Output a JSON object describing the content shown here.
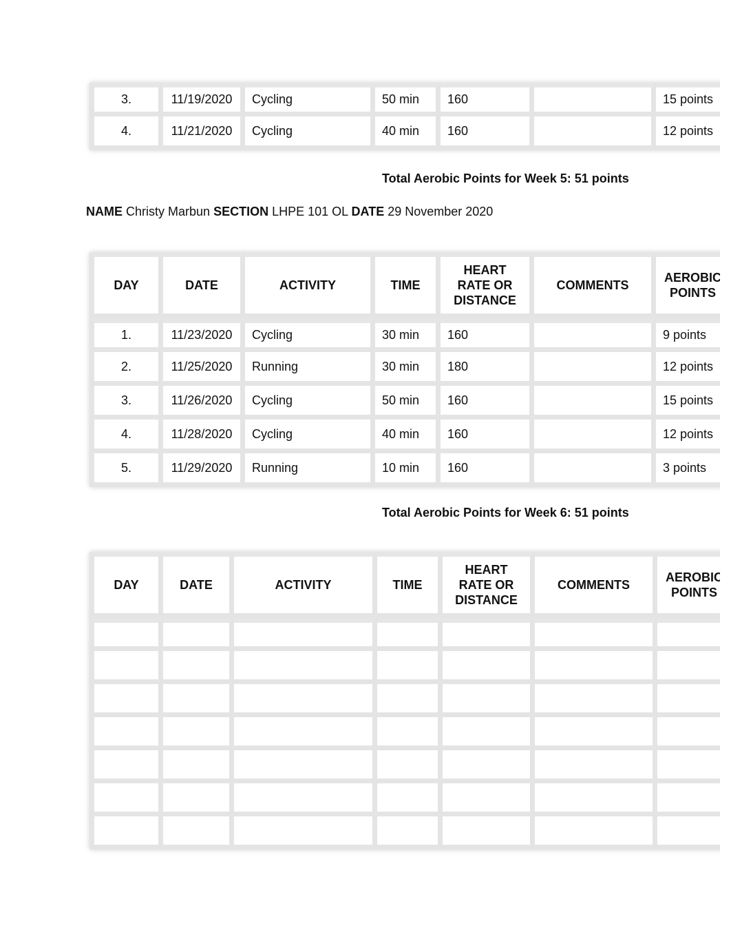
{
  "headers": {
    "day": "DAY",
    "date": "DATE",
    "activity": "ACTIVITY",
    "time": "TIME",
    "heart_rate": [
      "HEART",
      "RATE OR",
      "DISTANCE"
    ],
    "comments": "COMMENTS",
    "aerobic_points": [
      "AEROBIC",
      "POINTS"
    ]
  },
  "week5_partial": {
    "rows": [
      {
        "day": "3.",
        "date": "11/19/2020",
        "activity": "Cycling",
        "time": "50 min",
        "heart_rate": "160",
        "comments": "",
        "points": "15 points"
      },
      {
        "day": "4.",
        "date": "11/21/2020",
        "activity": "Cycling",
        "time": "40 min",
        "heart_rate": "160",
        "comments": "",
        "points": "12 points"
      }
    ],
    "total": "Total Aerobic Points for Week 5: 51 points"
  },
  "student": {
    "name_label": "NAME",
    "name": "Christy Marbun",
    "section_label": "SECTION",
    "section": "LHPE 101 OL",
    "date_label": "DATE",
    "date": "29 November 2020"
  },
  "week6": {
    "rows": [
      {
        "day": "1.",
        "date": "11/23/2020",
        "activity": "Cycling",
        "time": "30 min",
        "heart_rate": "160",
        "comments": "",
        "points": "9 points"
      },
      {
        "day": "2.",
        "date": "11/25/2020",
        "activity": "Running",
        "time": "30 min",
        "heart_rate": "180",
        "comments": "",
        "points": "12 points"
      },
      {
        "day": "3.",
        "date": "11/26/2020",
        "activity": "Cycling",
        "time": "50 min",
        "heart_rate": "160",
        "comments": "",
        "points": "15 points"
      },
      {
        "day": "4.",
        "date": "11/28/2020",
        "activity": "Cycling",
        "time": "40 min",
        "heart_rate": "160",
        "comments": "",
        "points": "12 points"
      },
      {
        "day": "5.",
        "date": "11/29/2020",
        "activity": "Running",
        "time": "10 min",
        "heart_rate": "160",
        "comments": "",
        "points": "3 points"
      }
    ],
    "total": "Total Aerobic Points for Week 6: 51 points"
  },
  "blank_log": {
    "empty_row_count": 7
  }
}
